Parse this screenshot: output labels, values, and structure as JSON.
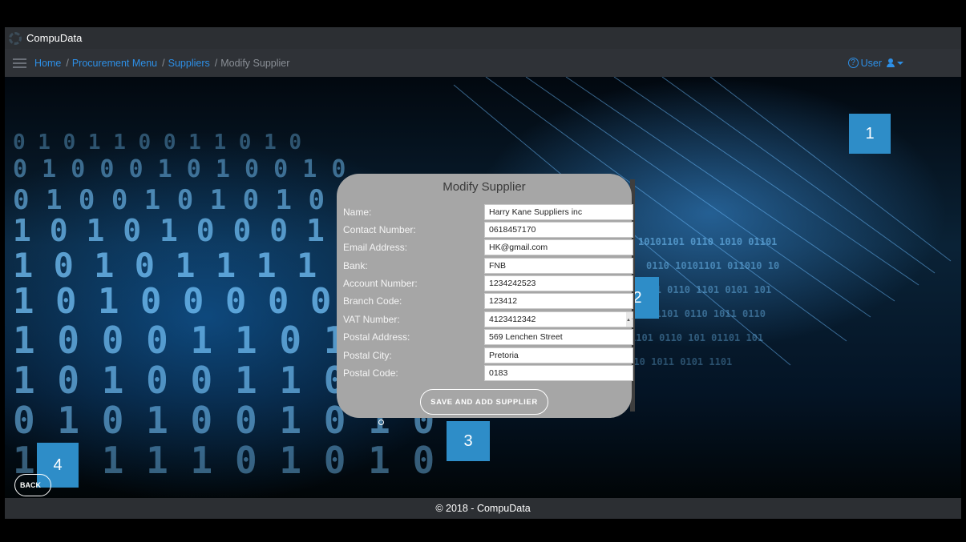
{
  "app": {
    "name": "CompuData"
  },
  "breadcrumb": [
    {
      "label": "Home",
      "link": true
    },
    {
      "label": "Procurement Menu",
      "link": true
    },
    {
      "label": "Suppliers",
      "link": true
    },
    {
      "label": "Modify Supplier",
      "link": false
    }
  ],
  "user_menu": {
    "help_glyph": "?",
    "label": "User"
  },
  "modal": {
    "title": "Modify Supplier",
    "fields": [
      {
        "label": "Name:",
        "value": "Harry Kane Suppliers inc"
      },
      {
        "label": "Contact Number:",
        "value": "0618457170"
      },
      {
        "label": "Email Address:",
        "value": "HK@gmail.com"
      },
      {
        "label": "Bank:",
        "value": "FNB"
      },
      {
        "label": "Account Number:",
        "value": "1234242523"
      },
      {
        "label": "Branch Code:",
        "value": "123412"
      },
      {
        "label": "VAT Number:",
        "value": "4123412342"
      },
      {
        "label": "Postal Address:",
        "value": "569 Lenchen Street"
      },
      {
        "label": "Postal City:",
        "value": "Pretoria"
      },
      {
        "label": "Postal Code:",
        "value": "0183"
      }
    ],
    "save_label": "SAVE AND ADD SUPPLIER"
  },
  "back_label": "BACK",
  "callouts": [
    "1",
    "2",
    "3",
    "4"
  ],
  "footer": {
    "text": "© 2018 - CompuData"
  },
  "colors": {
    "link": "#2d8fe6",
    "callout": "#2e8dc8",
    "modal": "#a6a6a6",
    "bar": "#2c2f33"
  }
}
